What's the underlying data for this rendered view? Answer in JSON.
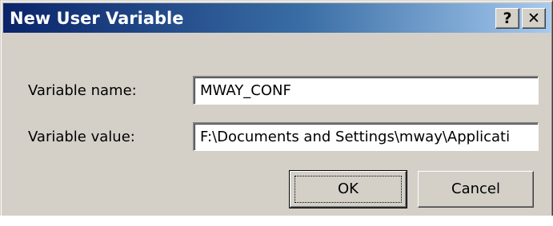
{
  "dialog": {
    "title": "New User Variable",
    "help_button": "?",
    "close_button": "✕"
  },
  "form": {
    "name_label": "Variable name:",
    "name_value": "MWAY_CONF",
    "value_label": "Variable value:",
    "value_value": "F:\\Documents and Settings\\mway\\Applicati"
  },
  "buttons": {
    "ok": "OK",
    "cancel": "Cancel"
  },
  "colors": {
    "titlebar_start": "#0a246a",
    "titlebar_end": "#a6caf0",
    "face": "#d4d0c8"
  }
}
